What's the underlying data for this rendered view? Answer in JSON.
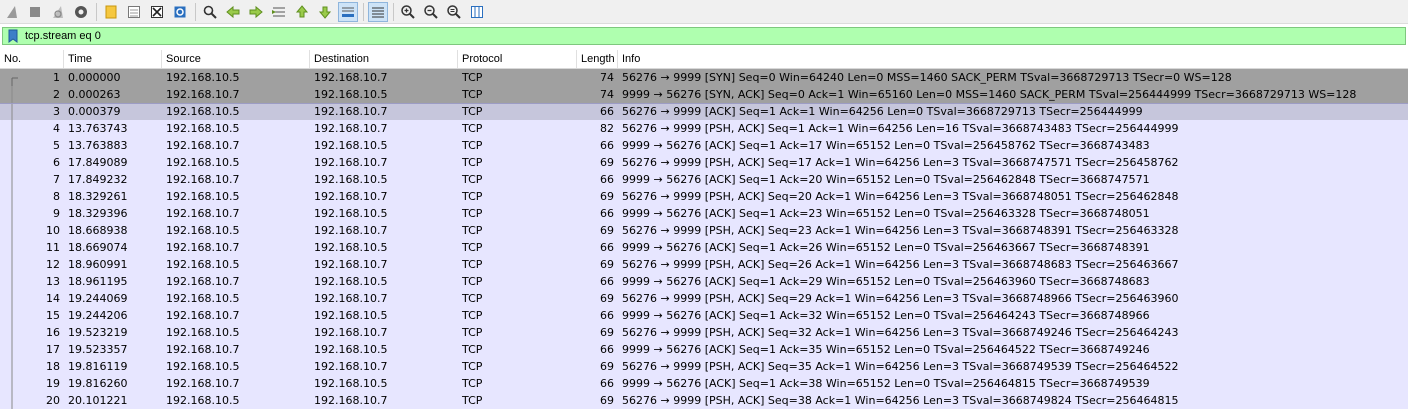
{
  "toolbar": {
    "buttons": [
      {
        "name": "start-capture-icon",
        "icon": "shark-fin"
      },
      {
        "name": "stop-capture-icon",
        "icon": "stop-square"
      },
      {
        "name": "restart-capture-icon",
        "icon": "shark-fin-restart"
      },
      {
        "name": "capture-options-icon",
        "icon": "gear"
      },
      {
        "name": "open-file-icon",
        "icon": "folder"
      },
      {
        "name": "save-file-icon",
        "icon": "save-grid"
      },
      {
        "name": "close-file-icon",
        "icon": "close-x"
      },
      {
        "name": "reload-file-icon",
        "icon": "reload"
      },
      {
        "name": "find-packet-icon",
        "icon": "magnifier"
      },
      {
        "name": "go-back-icon",
        "icon": "arrow-left"
      },
      {
        "name": "go-forward-icon",
        "icon": "arrow-right"
      },
      {
        "name": "go-to-packet-icon",
        "icon": "goto-lines"
      },
      {
        "name": "go-first-packet-icon",
        "icon": "arrow-up-bar"
      },
      {
        "name": "go-last-packet-icon",
        "icon": "arrow-down-bar"
      },
      {
        "name": "auto-scroll-icon",
        "icon": "autoscroll"
      },
      {
        "name": "colorize-icon",
        "icon": "lines"
      },
      {
        "name": "zoom-in-icon",
        "icon": "zoom-in"
      },
      {
        "name": "zoom-out-icon",
        "icon": "zoom-out"
      },
      {
        "name": "normal-size-icon",
        "icon": "zoom-normal"
      },
      {
        "name": "resize-columns-icon",
        "icon": "resize-columns"
      }
    ]
  },
  "filter": {
    "text": "tcp.stream eq 0",
    "bg": "#afffaf"
  },
  "columns": {
    "no": "No.",
    "time": "Time",
    "source": "Source",
    "destination": "Destination",
    "protocol": "Protocol",
    "length": "Length",
    "info": "Info"
  },
  "colors": {
    "syn_row": "#a0a0a0",
    "selected_row": "#c6c6dc",
    "normal_row": "#e7e6ff"
  },
  "packets": [
    {
      "no": "1",
      "time": "0.000000",
      "src": "192.168.10.5",
      "dst": "192.168.10.7",
      "proto": "TCP",
      "len": "74",
      "info": "56276 → 9999 [SYN] Seq=0 Win=64240 Len=0 MSS=1460 SACK_PERM TSval=3668729713 TSecr=0 WS=128",
      "style": "syn"
    },
    {
      "no": "2",
      "time": "0.000263",
      "src": "192.168.10.7",
      "dst": "192.168.10.5",
      "proto": "TCP",
      "len": "74",
      "info": "9999 → 56276 [SYN, ACK] Seq=0 Ack=1 Win=65160 Len=0 MSS=1460 SACK_PERM TSval=256444999 TSecr=3668729713 WS=128",
      "style": "syn"
    },
    {
      "no": "3",
      "time": "0.000379",
      "src": "192.168.10.5",
      "dst": "192.168.10.7",
      "proto": "TCP",
      "len": "66",
      "info": "56276 → 9999 [ACK] Seq=1 Ack=1 Win=64256 Len=0 TSval=3668729713 TSecr=256444999",
      "style": "selected"
    },
    {
      "no": "4",
      "time": "13.763743",
      "src": "192.168.10.5",
      "dst": "192.168.10.7",
      "proto": "TCP",
      "len": "82",
      "info": "56276 → 9999 [PSH, ACK] Seq=1 Ack=1 Win=64256 Len=16 TSval=3668743483 TSecr=256444999",
      "style": "normal"
    },
    {
      "no": "5",
      "time": "13.763883",
      "src": "192.168.10.7",
      "dst": "192.168.10.5",
      "proto": "TCP",
      "len": "66",
      "info": "9999 → 56276 [ACK] Seq=1 Ack=17 Win=65152 Len=0 TSval=256458762 TSecr=3668743483",
      "style": "normal"
    },
    {
      "no": "6",
      "time": "17.849089",
      "src": "192.168.10.5",
      "dst": "192.168.10.7",
      "proto": "TCP",
      "len": "69",
      "info": "56276 → 9999 [PSH, ACK] Seq=17 Ack=1 Win=64256 Len=3 TSval=3668747571 TSecr=256458762",
      "style": "normal"
    },
    {
      "no": "7",
      "time": "17.849232",
      "src": "192.168.10.7",
      "dst": "192.168.10.5",
      "proto": "TCP",
      "len": "66",
      "info": "9999 → 56276 [ACK] Seq=1 Ack=20 Win=65152 Len=0 TSval=256462848 TSecr=3668747571",
      "style": "normal"
    },
    {
      "no": "8",
      "time": "18.329261",
      "src": "192.168.10.5",
      "dst": "192.168.10.7",
      "proto": "TCP",
      "len": "69",
      "info": "56276 → 9999 [PSH, ACK] Seq=20 Ack=1 Win=64256 Len=3 TSval=3668748051 TSecr=256462848",
      "style": "normal"
    },
    {
      "no": "9",
      "time": "18.329396",
      "src": "192.168.10.7",
      "dst": "192.168.10.5",
      "proto": "TCP",
      "len": "66",
      "info": "9999 → 56276 [ACK] Seq=1 Ack=23 Win=65152 Len=0 TSval=256463328 TSecr=3668748051",
      "style": "normal"
    },
    {
      "no": "10",
      "time": "18.668938",
      "src": "192.168.10.5",
      "dst": "192.168.10.7",
      "proto": "TCP",
      "len": "69",
      "info": "56276 → 9999 [PSH, ACK] Seq=23 Ack=1 Win=64256 Len=3 TSval=3668748391 TSecr=256463328",
      "style": "normal"
    },
    {
      "no": "11",
      "time": "18.669074",
      "src": "192.168.10.7",
      "dst": "192.168.10.5",
      "proto": "TCP",
      "len": "66",
      "info": "9999 → 56276 [ACK] Seq=1 Ack=26 Win=65152 Len=0 TSval=256463667 TSecr=3668748391",
      "style": "normal"
    },
    {
      "no": "12",
      "time": "18.960991",
      "src": "192.168.10.5",
      "dst": "192.168.10.7",
      "proto": "TCP",
      "len": "69",
      "info": "56276 → 9999 [PSH, ACK] Seq=26 Ack=1 Win=64256 Len=3 TSval=3668748683 TSecr=256463667",
      "style": "normal"
    },
    {
      "no": "13",
      "time": "18.961195",
      "src": "192.168.10.7",
      "dst": "192.168.10.5",
      "proto": "TCP",
      "len": "66",
      "info": "9999 → 56276 [ACK] Seq=1 Ack=29 Win=65152 Len=0 TSval=256463960 TSecr=3668748683",
      "style": "normal"
    },
    {
      "no": "14",
      "time": "19.244069",
      "src": "192.168.10.5",
      "dst": "192.168.10.7",
      "proto": "TCP",
      "len": "69",
      "info": "56276 → 9999 [PSH, ACK] Seq=29 Ack=1 Win=64256 Len=3 TSval=3668748966 TSecr=256463960",
      "style": "normal"
    },
    {
      "no": "15",
      "time": "19.244206",
      "src": "192.168.10.7",
      "dst": "192.168.10.5",
      "proto": "TCP",
      "len": "66",
      "info": "9999 → 56276 [ACK] Seq=1 Ack=32 Win=65152 Len=0 TSval=256464243 TSecr=3668748966",
      "style": "normal"
    },
    {
      "no": "16",
      "time": "19.523219",
      "src": "192.168.10.5",
      "dst": "192.168.10.7",
      "proto": "TCP",
      "len": "69",
      "info": "56276 → 9999 [PSH, ACK] Seq=32 Ack=1 Win=64256 Len=3 TSval=3668749246 TSecr=256464243",
      "style": "normal"
    },
    {
      "no": "17",
      "time": "19.523357",
      "src": "192.168.10.7",
      "dst": "192.168.10.5",
      "proto": "TCP",
      "len": "66",
      "info": "9999 → 56276 [ACK] Seq=1 Ack=35 Win=65152 Len=0 TSval=256464522 TSecr=3668749246",
      "style": "normal"
    },
    {
      "no": "18",
      "time": "19.816119",
      "src": "192.168.10.5",
      "dst": "192.168.10.7",
      "proto": "TCP",
      "len": "69",
      "info": "56276 → 9999 [PSH, ACK] Seq=35 Ack=1 Win=64256 Len=3 TSval=3668749539 TSecr=256464522",
      "style": "normal"
    },
    {
      "no": "19",
      "time": "19.816260",
      "src": "192.168.10.7",
      "dst": "192.168.10.5",
      "proto": "TCP",
      "len": "66",
      "info": "9999 → 56276 [ACK] Seq=1 Ack=38 Win=65152 Len=0 TSval=256464815 TSecr=3668749539",
      "style": "normal"
    },
    {
      "no": "20",
      "time": "20.101221",
      "src": "192.168.10.5",
      "dst": "192.168.10.7",
      "proto": "TCP",
      "len": "69",
      "info": "56276 → 9999 [PSH, ACK] Seq=38 Ack=1 Win=64256 Len=3 TSval=3668749824 TSecr=256464815",
      "style": "normal"
    }
  ]
}
